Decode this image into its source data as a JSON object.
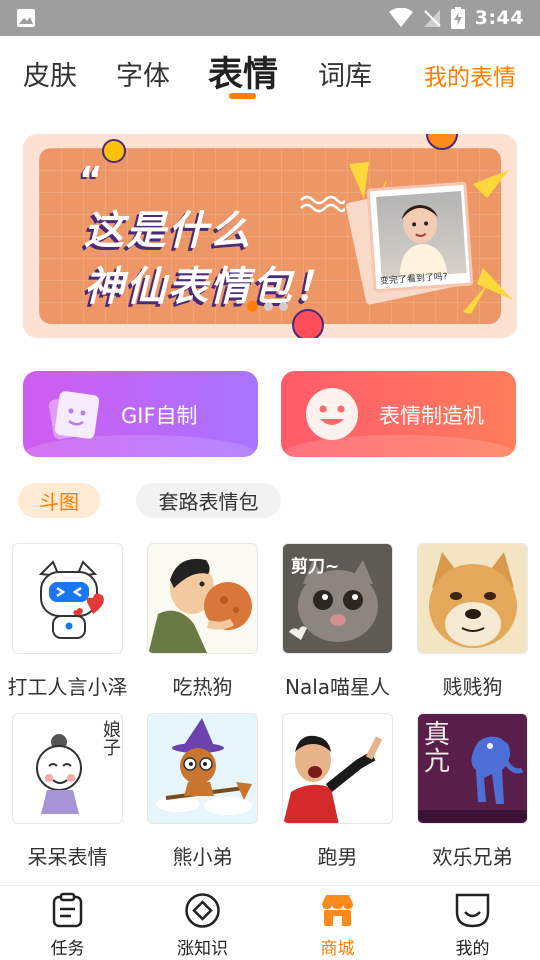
{
  "status_bar": {
    "time": "3:44",
    "icons": [
      "gallery-icon",
      "wifi-icon",
      "signal-off-icon",
      "battery-charging-icon"
    ]
  },
  "top_tabs": {
    "tabs": [
      {
        "label": "皮肤",
        "active": false
      },
      {
        "label": "字体",
        "active": false
      },
      {
        "label": "表情",
        "active": true
      },
      {
        "label": "词库",
        "active": false
      }
    ],
    "my_emoji_label": "我的表情",
    "accent": "#ff7d00"
  },
  "banner": {
    "quote_mark": "“",
    "line1": "这是什么",
    "line2": "神仙表情包！",
    "photo_caption": "变完了看到了吗?",
    "page_count": 3,
    "active_page": 1
  },
  "actions": {
    "gif_label": "GIF自制",
    "maker_label": "表情制造机",
    "gif_gradient": [
      "#d05cf0",
      "#a774ff"
    ],
    "maker_gradient": [
      "#ff5b6a",
      "#ff7d5c"
    ]
  },
  "categories": [
    {
      "label": "斗图",
      "active": true
    },
    {
      "label": "套路表情包",
      "active": false
    }
  ],
  "packs": [
    {
      "label": "打工人言小泽",
      "icon": "robot-sticker-icon",
      "overlay_text": ""
    },
    {
      "label": "吃热狗",
      "icon": "man-eating-icon",
      "overlay_text": ""
    },
    {
      "label": "Nala喵星人",
      "icon": "cat-sticker-icon",
      "overlay_text": "剪刀~"
    },
    {
      "label": "贱贱狗",
      "icon": "doge-icon",
      "overlay_text": ""
    },
    {
      "label": "呆呆表情",
      "icon": "cartoon-face-icon",
      "overlay_text": "娘子"
    },
    {
      "label": "熊小弟",
      "icon": "bear-witch-icon",
      "overlay_text": ""
    },
    {
      "label": "跑男",
      "icon": "man-shouting-icon",
      "overlay_text": ""
    },
    {
      "label": "欢乐兄弟",
      "icon": "blue-creature-icon",
      "overlay_text": "真亢"
    }
  ],
  "bottom_nav": [
    {
      "label": "任务",
      "icon": "clipboard-icon",
      "active": false
    },
    {
      "label": "涨知识",
      "icon": "compass-icon",
      "active": false
    },
    {
      "label": "商城",
      "icon": "store-icon",
      "active": true
    },
    {
      "label": "我的",
      "icon": "smile-icon",
      "active": false
    }
  ]
}
